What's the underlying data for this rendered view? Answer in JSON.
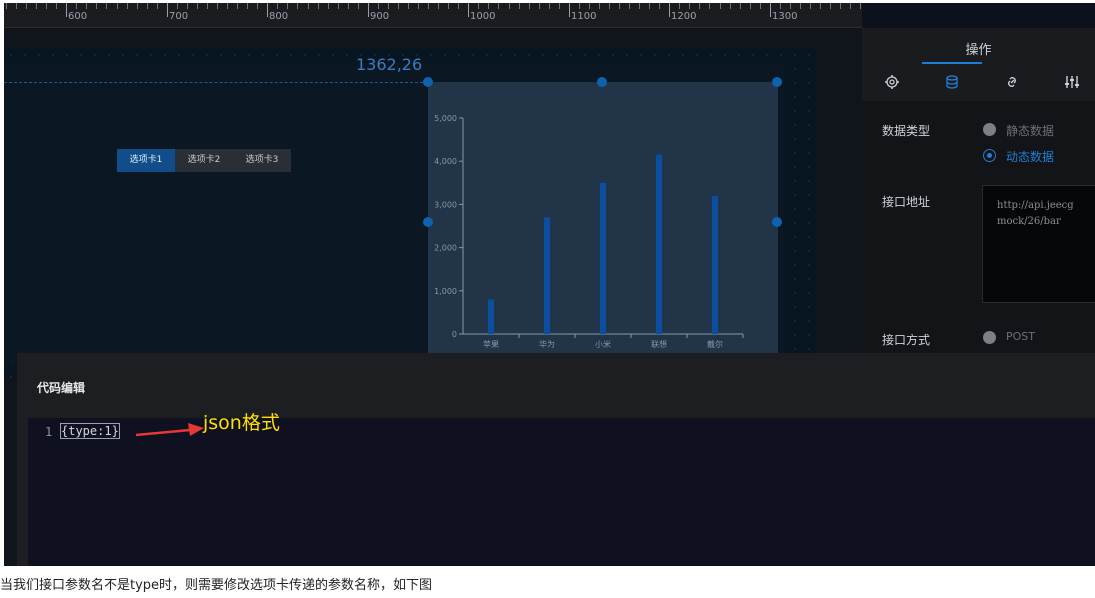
{
  "ruler": {
    "ticks": [
      "600",
      "700",
      "800",
      "900",
      "1000",
      "1100",
      "1200",
      "1300"
    ]
  },
  "canvas": {
    "coordinate_readout": "1362,26"
  },
  "tabs": [
    {
      "label": "选项卡1",
      "active": true
    },
    {
      "label": "选项卡2",
      "active": false
    },
    {
      "label": "选项卡3",
      "active": false
    }
  ],
  "chart_data": {
    "type": "bar",
    "categories": [
      "苹果",
      "华为",
      "小米",
      "联想",
      "戴尔"
    ],
    "values": [
      800,
      2700,
      3500,
      4150,
      3200
    ],
    "yticks": [
      "0",
      "1,000",
      "2,000",
      "3,000",
      "4,000",
      "5,000"
    ],
    "ylim": [
      0,
      5000
    ],
    "bar_color": "#0b4d9e"
  },
  "panel": {
    "title": "操作",
    "icons": [
      "gear-icon",
      "database-icon",
      "link-icon",
      "sliders-icon"
    ],
    "data_type_label": "数据类型",
    "data_type_options": [
      {
        "label": "静态数据",
        "selected": false
      },
      {
        "label": "动态数据",
        "selected": true
      }
    ],
    "api_url_label": "接口地址",
    "api_url_value": "http://api.jeecg\nmock/26/bar",
    "api_method_label": "接口方式",
    "api_method_option": "POST"
  },
  "editor": {
    "title": "代码编辑",
    "line_number": "1",
    "code": "{type:1}"
  },
  "annotation": "json格式",
  "caption": "当我们接口参数名不是type时，则需要修改选项卡传递的参数名称，如下图",
  "colors": {
    "accent": "#1f7fd6",
    "annotation": "#ffe000",
    "arrow": "#e53935"
  }
}
